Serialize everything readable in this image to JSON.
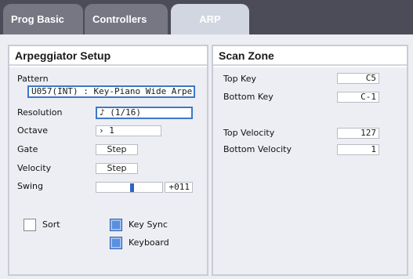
{
  "tabs": [
    {
      "label": "Prog Basic"
    },
    {
      "label": "Controllers"
    },
    {
      "label": "ARP"
    }
  ],
  "arp_setup": {
    "title": "Arpeggiator Setup",
    "pattern_label": "Pattern",
    "pattern_value": "U057(INT) : Key-Piano Wide Arpe",
    "resolution_label": "Resolution",
    "resolution_value": "♪ (1/16)",
    "octave_label": "Octave",
    "octave_value": "› 1",
    "gate_label": "Gate",
    "gate_value": "Step",
    "velocity_label": "Velocity",
    "velocity_value": "Step",
    "swing_label": "Swing",
    "swing_value": "+011",
    "swing_level": 0.55,
    "sort_label": "Sort",
    "sort_checked": false,
    "key_sync_label": "Key Sync",
    "key_sync_checked": true,
    "keyboard_label": "Keyboard",
    "keyboard_checked": true
  },
  "scan_zone": {
    "title": "Scan Zone",
    "top_key_label": "Top Key",
    "top_key_value": "C5",
    "bottom_key_label": "Bottom Key",
    "bottom_key_value": "C-1",
    "top_velocity_label": "Top Velocity",
    "top_velocity_value": "127",
    "bottom_velocity_label": "Bottom Velocity",
    "bottom_velocity_value": "1"
  },
  "colors": {
    "tab_bar": "#4c4c58",
    "active_tab": "#d2d6e0",
    "highlight": "#3d78c8",
    "checkbox_on": "#5a8fe0"
  }
}
